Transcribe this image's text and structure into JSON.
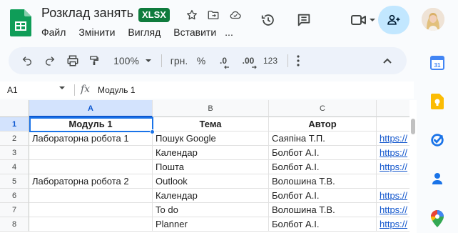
{
  "doc": {
    "title": "Розклад занять",
    "format_badge": "XLSX"
  },
  "title_icons": [
    "star-icon",
    "move-to-folder-icon",
    "cloud-saved-icon"
  ],
  "menu": {
    "items": [
      "Файл",
      "Змінити",
      "Вигляд",
      "Вставити"
    ],
    "more": "..."
  },
  "header_actions": [
    "history-icon",
    "comments-icon",
    "meet-icon",
    "share-icon",
    "avatar"
  ],
  "toolbar": {
    "zoom": "100%",
    "currency": "грн.",
    "percent": "%",
    "decrease_decimal": ".0",
    "increase_decimal": ".00",
    "number_format": "123"
  },
  "formula_bar": {
    "cell_ref": "A1",
    "fx": "fx",
    "content": "Модуль 1"
  },
  "sheet": {
    "columns": [
      "A",
      "B",
      "C",
      ""
    ],
    "rows": [
      {
        "num": "1",
        "cells": [
          "Модуль 1",
          "Тема",
          "Автор",
          ""
        ]
      },
      {
        "num": "2",
        "cells": [
          "Лабораторна робота 1",
          "Пошук Google",
          "Саяпіна Т.П.",
          "https://"
        ]
      },
      {
        "num": "3",
        "cells": [
          "",
          "Календар",
          "Болбот А.І.",
          "https://"
        ]
      },
      {
        "num": "4",
        "cells": [
          "",
          "Пошта",
          "Болбот А.І.",
          "https://"
        ]
      },
      {
        "num": "5",
        "cells": [
          "Лабораторна робота 2",
          "Outlook",
          "Волошина Т.В.",
          ""
        ]
      },
      {
        "num": "6",
        "cells": [
          "",
          "Календар",
          "Болбот А.І.",
          "https://"
        ]
      },
      {
        "num": "7",
        "cells": [
          "",
          "To do",
          "Волошина Т.В.",
          "https://"
        ]
      },
      {
        "num": "8",
        "cells": [
          "",
          "Planner",
          "Болбот А.І.",
          "https://"
        ]
      }
    ]
  },
  "side_panel": [
    "calendar-icon",
    "keep-icon",
    "tasks-icon",
    "contacts-icon",
    "maps-icon"
  ],
  "colors": {
    "accent": "#0b57d0",
    "share_bg": "#c2e7ff",
    "sheets_green": "#0f9d58",
    "badge_green": "#0f7b3d",
    "link": "#1155cc"
  }
}
